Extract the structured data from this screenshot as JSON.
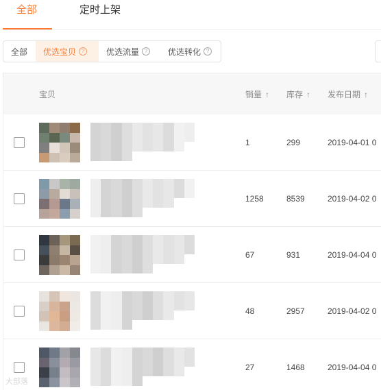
{
  "top_tabs": [
    {
      "label": "全部",
      "active": true
    },
    {
      "label": "定时上架",
      "active": false
    }
  ],
  "accent_color": "#ff7a2e",
  "filters": [
    {
      "label": "全部",
      "help": false,
      "active": false
    },
    {
      "label": "优选宝贝",
      "help": true,
      "active": true
    },
    {
      "label": "优选流量",
      "help": true,
      "active": false
    },
    {
      "label": "优选转化",
      "help": true,
      "active": false
    }
  ],
  "help_icon_glyph": "?",
  "table": {
    "headers": {
      "item": "宝贝",
      "sales": "销量",
      "stock": "库存",
      "date": "发布日期"
    },
    "sort_glyph": "↑",
    "rows": [
      {
        "sales": "1",
        "stock": "299",
        "date": "2019-04-01 0",
        "checked": false
      },
      {
        "sales": "1258",
        "stock": "8539",
        "date": "2019-04-02 0",
        "checked": false
      },
      {
        "sales": "67",
        "stock": "931",
        "date": "2019-04-04 0",
        "checked": false
      },
      {
        "sales": "48",
        "stock": "2957",
        "date": "2019-04-02 0",
        "checked": false
      },
      {
        "sales": "27",
        "stock": "1468",
        "date": "2019-04-04 0",
        "checked": false
      }
    ]
  },
  "watermark": "大部落"
}
